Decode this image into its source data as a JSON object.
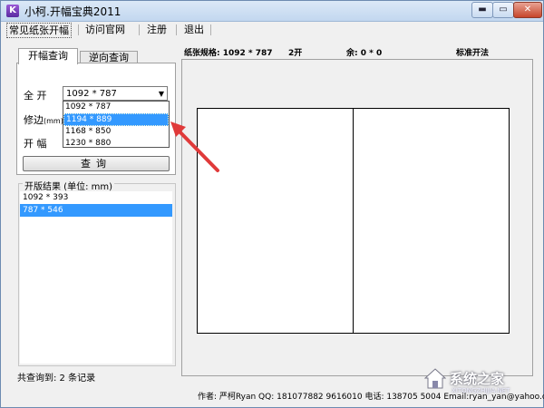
{
  "window": {
    "title": "小柯.开幅宝典2011",
    "min_glyph": "▬",
    "max_glyph": "▭",
    "close_glyph": "✕"
  },
  "menu": [
    "常见纸张开幅",
    "访问官网",
    "注册",
    "退出"
  ],
  "tabs": [
    "开幅查询",
    "逆向查询"
  ],
  "form": {
    "full_label": "全 开",
    "trim_label": "修边",
    "trim_unit": "(mm)",
    "kaifu_label": "开 幅",
    "combo_value": "1092 * 787",
    "combo_arrow": "▼",
    "dropdown_options": [
      "1092 * 787",
      "1194 * 889",
      "1168 * 850",
      "1230 * 880"
    ],
    "selected_option": 1,
    "query_label": "查询"
  },
  "results": {
    "legend": "开版结果 (单位: mm)",
    "items": [
      "1092 * 393",
      "787 * 546"
    ],
    "selected": 1
  },
  "status": {
    "count_text": "共查询到: 2 条记录"
  },
  "info": {
    "paper_spec": "纸张规格: 1092 * 787",
    "kai": "2开",
    "remainder": "余: 0 * 0",
    "standard": "标准开法"
  },
  "footer": "作者: 严柯Ryan QQ: 181077882 9616010 电话: 138705  5004 Email:ryan_yan@yahoo.com",
  "watermark": {
    "text": "系统之家",
    "url": "XITONGZHIJIA.NET"
  },
  "colors": {
    "selection": "#3399ff",
    "arrow": "#e03a3a"
  }
}
